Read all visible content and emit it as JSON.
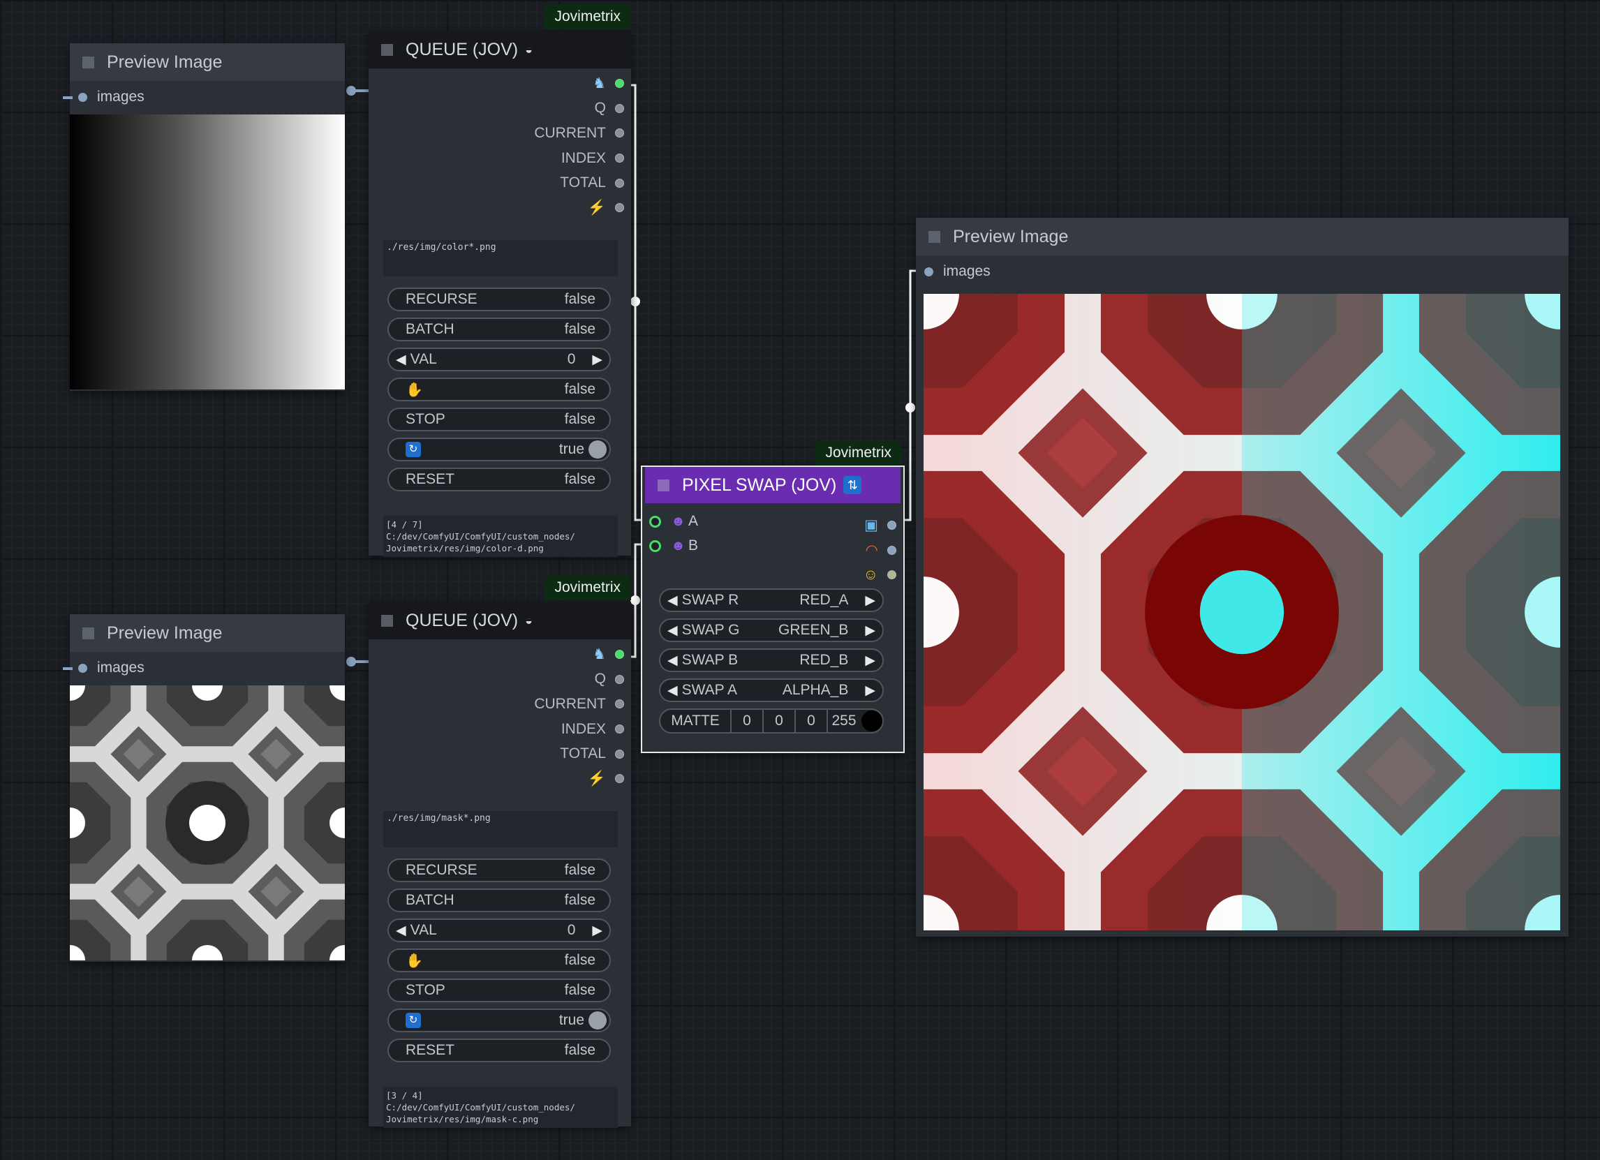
{
  "app": "ComfyUI",
  "colors": {
    "pixel_swap_header": "#6a2cb0",
    "badge_bg": "#0d2a12",
    "connected_slot": "#4cdc6a",
    "wire": "#ffffff"
  },
  "preview1": {
    "title": "Preview Image",
    "input": "images",
    "image": "horizontal black-to-white gradient"
  },
  "preview2": {
    "title": "Preview Image",
    "input": "images",
    "image": "grayscale kaleidoscope octagon pattern"
  },
  "preview3": {
    "title": "Preview Image",
    "input": "images",
    "image": "red and cyan kaleidoscope octagon pattern"
  },
  "queue1": {
    "badge": "Jovimetrix",
    "title": "QUEUE (JOV)",
    "title_icon": "layers-icon",
    "outputs": [
      "",
      "Q",
      "CURRENT",
      "INDEX",
      "TOTAL",
      ""
    ],
    "output_icons": [
      "unicorn-icon",
      "",
      "",
      "",
      "",
      "lightning-icon"
    ],
    "path": "./res/img/color*.png",
    "widgets": {
      "recurse": {
        "label": "RECURSE",
        "value": "false"
      },
      "batch": {
        "label": "BATCH",
        "value": "false"
      },
      "val": {
        "label": "VAL",
        "value": "0"
      },
      "hold": {
        "icon": "hand-icon",
        "value": "false"
      },
      "stop": {
        "label": "STOP",
        "value": "false"
      },
      "loop": {
        "icon": "loop-icon",
        "value": "true"
      },
      "reset": {
        "label": "RESET",
        "value": "false"
      }
    },
    "status": [
      "[4 / 7]",
      "C:/dev/ComfyUI/ComfyUI/custom_nodes/",
      "Jovimetrix/res/img/color-d.png"
    ]
  },
  "queue2": {
    "badge": "Jovimetrix",
    "title": "QUEUE (JOV)",
    "title_icon": "layers-icon",
    "outputs": [
      "",
      "Q",
      "CURRENT",
      "INDEX",
      "TOTAL",
      ""
    ],
    "output_icons": [
      "unicorn-icon",
      "",
      "",
      "",
      "",
      "lightning-icon"
    ],
    "path": "./res/img/mask*.png",
    "widgets": {
      "recurse": {
        "label": "RECURSE",
        "value": "false"
      },
      "batch": {
        "label": "BATCH",
        "value": "false"
      },
      "val": {
        "label": "VAL",
        "value": "0"
      },
      "hold": {
        "icon": "hand-icon",
        "value": "false"
      },
      "stop": {
        "label": "STOP",
        "value": "false"
      },
      "loop": {
        "icon": "loop-icon",
        "value": "true"
      },
      "reset": {
        "label": "RESET",
        "value": "false"
      }
    },
    "status": [
      "[3 / 4]",
      "C:/dev/ComfyUI/ComfyUI/custom_nodes/",
      "Jovimetrix/res/img/mask-c.png"
    ]
  },
  "pixelswap": {
    "badge": "Jovimetrix",
    "title": "PIXEL SWAP (JOV)",
    "title_icon": "swap-icon",
    "inputs": [
      "A",
      "B"
    ],
    "input_icons": [
      "alien-icon",
      "alien-icon"
    ],
    "output_icons": [
      "image-icon",
      "rainbow-icon",
      "mask-face-icon"
    ],
    "swap_r": {
      "label": "SWAP R",
      "value": "RED_A"
    },
    "swap_g": {
      "label": "SWAP G",
      "value": "GREEN_B"
    },
    "swap_b": {
      "label": "SWAP B",
      "value": "RED_B"
    },
    "swap_a": {
      "label": "SWAP A",
      "value": "ALPHA_B"
    },
    "matte": {
      "label": "MATTE",
      "r": "0",
      "g": "0",
      "b": "0",
      "a": "255",
      "swatch": "#000000"
    }
  }
}
